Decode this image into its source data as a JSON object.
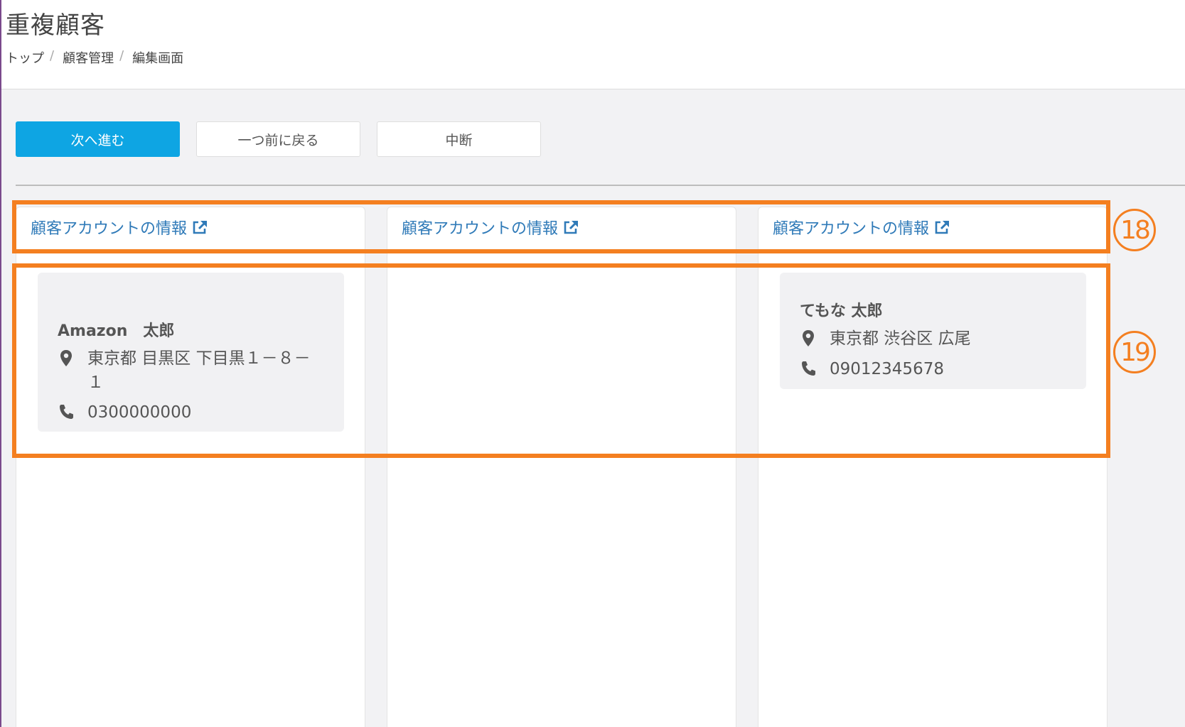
{
  "page": {
    "title": "重複顧客"
  },
  "breadcrumb": [
    {
      "label": "トップ"
    },
    {
      "label": "顧客管理"
    },
    {
      "label": "編集画面"
    }
  ],
  "toolbar": {
    "next_label": "次へ進む",
    "back_label": "一つ前に戻る",
    "abort_label": "中断"
  },
  "columns": [
    {
      "link_label": "顧客アカウントの情報",
      "card": {
        "name": "Amazon　太郎",
        "address": "東京都 目黒区 下目黒１－８－１",
        "phone": "0300000000"
      }
    },
    {
      "link_label": "顧客アカウントの情報"
    },
    {
      "link_label": "顧客アカウントの情報",
      "card": {
        "name": "てもな 太郎",
        "address": "東京都 渋谷区 広尾",
        "phone": "09012345678"
      }
    }
  ],
  "annotations": {
    "header_number": "18",
    "body_number": "19"
  },
  "icons": {
    "external": "external-link-icon",
    "location": "map-pin-icon",
    "phone": "phone-icon"
  },
  "colors": {
    "primary": "#0ea5e3",
    "link": "#2f7ab8",
    "annotation": "#f47f20"
  }
}
